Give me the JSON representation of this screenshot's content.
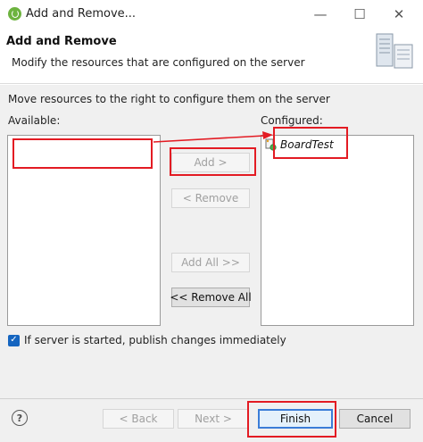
{
  "window": {
    "title": "Add and Remove...",
    "minimize_glyph": "—",
    "maximize_glyph": "☐",
    "close_glyph": "✕"
  },
  "header": {
    "title": "Add and Remove",
    "description": "Modify the resources that are configured on the server"
  },
  "instructions": "Move resources to the right to configure them on the server",
  "available": {
    "label": "Available:",
    "items": []
  },
  "configured": {
    "label": "Configured:",
    "items": [
      {
        "name": "BoardTest",
        "icon": "web-project-icon"
      }
    ]
  },
  "move_buttons": {
    "add": "Add >",
    "remove": "< Remove",
    "add_all": "Add All >>",
    "remove_all": "<< Remove All"
  },
  "publish_option": {
    "label": "If server is started, publish changes immediately",
    "checked": true
  },
  "footer": {
    "help": "?",
    "back": "< Back",
    "next": "Next >",
    "finish": "Finish",
    "cancel": "Cancel"
  },
  "annotation_color": "#e31b23",
  "accent_color": "#3b7dd8"
}
